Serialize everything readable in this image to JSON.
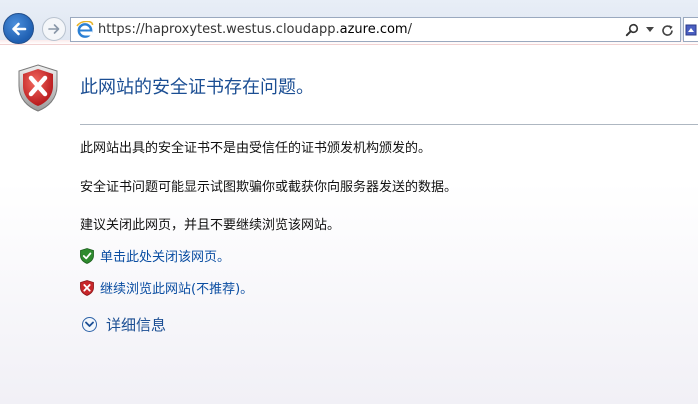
{
  "browser": {
    "url_prefix": "https://haproxytest.westus.cloudapp.",
    "url_domain": "azure.com",
    "url_suffix": "/",
    "icons": {
      "back": "back-arrow-icon",
      "forward": "forward-arrow-icon",
      "site": "ie-logo-icon",
      "search": "search-icon",
      "dropdown": "dropdown-arrow-icon",
      "refresh": "refresh-icon"
    }
  },
  "page": {
    "title": "此网站的安全证书存在问题。",
    "paragraph1": "此网站出具的安全证书不是由受信任的证书颁发机构颁发的。",
    "paragraph2": "安全证书问题可能显示试图欺骗你或截获你向服务器发送的数据。",
    "paragraph3": "建议关闭此网页，并且不要继续浏览该网站。",
    "link_close": "单击此处关闭该网页。",
    "link_continue": "继续浏览此网站(不推荐)。",
    "details_label": "详细信息"
  },
  "colors": {
    "title": "#1b4e93",
    "link": "#0b4ea2",
    "error_red": "#c8262a",
    "ok_green": "#2e8b2e"
  }
}
